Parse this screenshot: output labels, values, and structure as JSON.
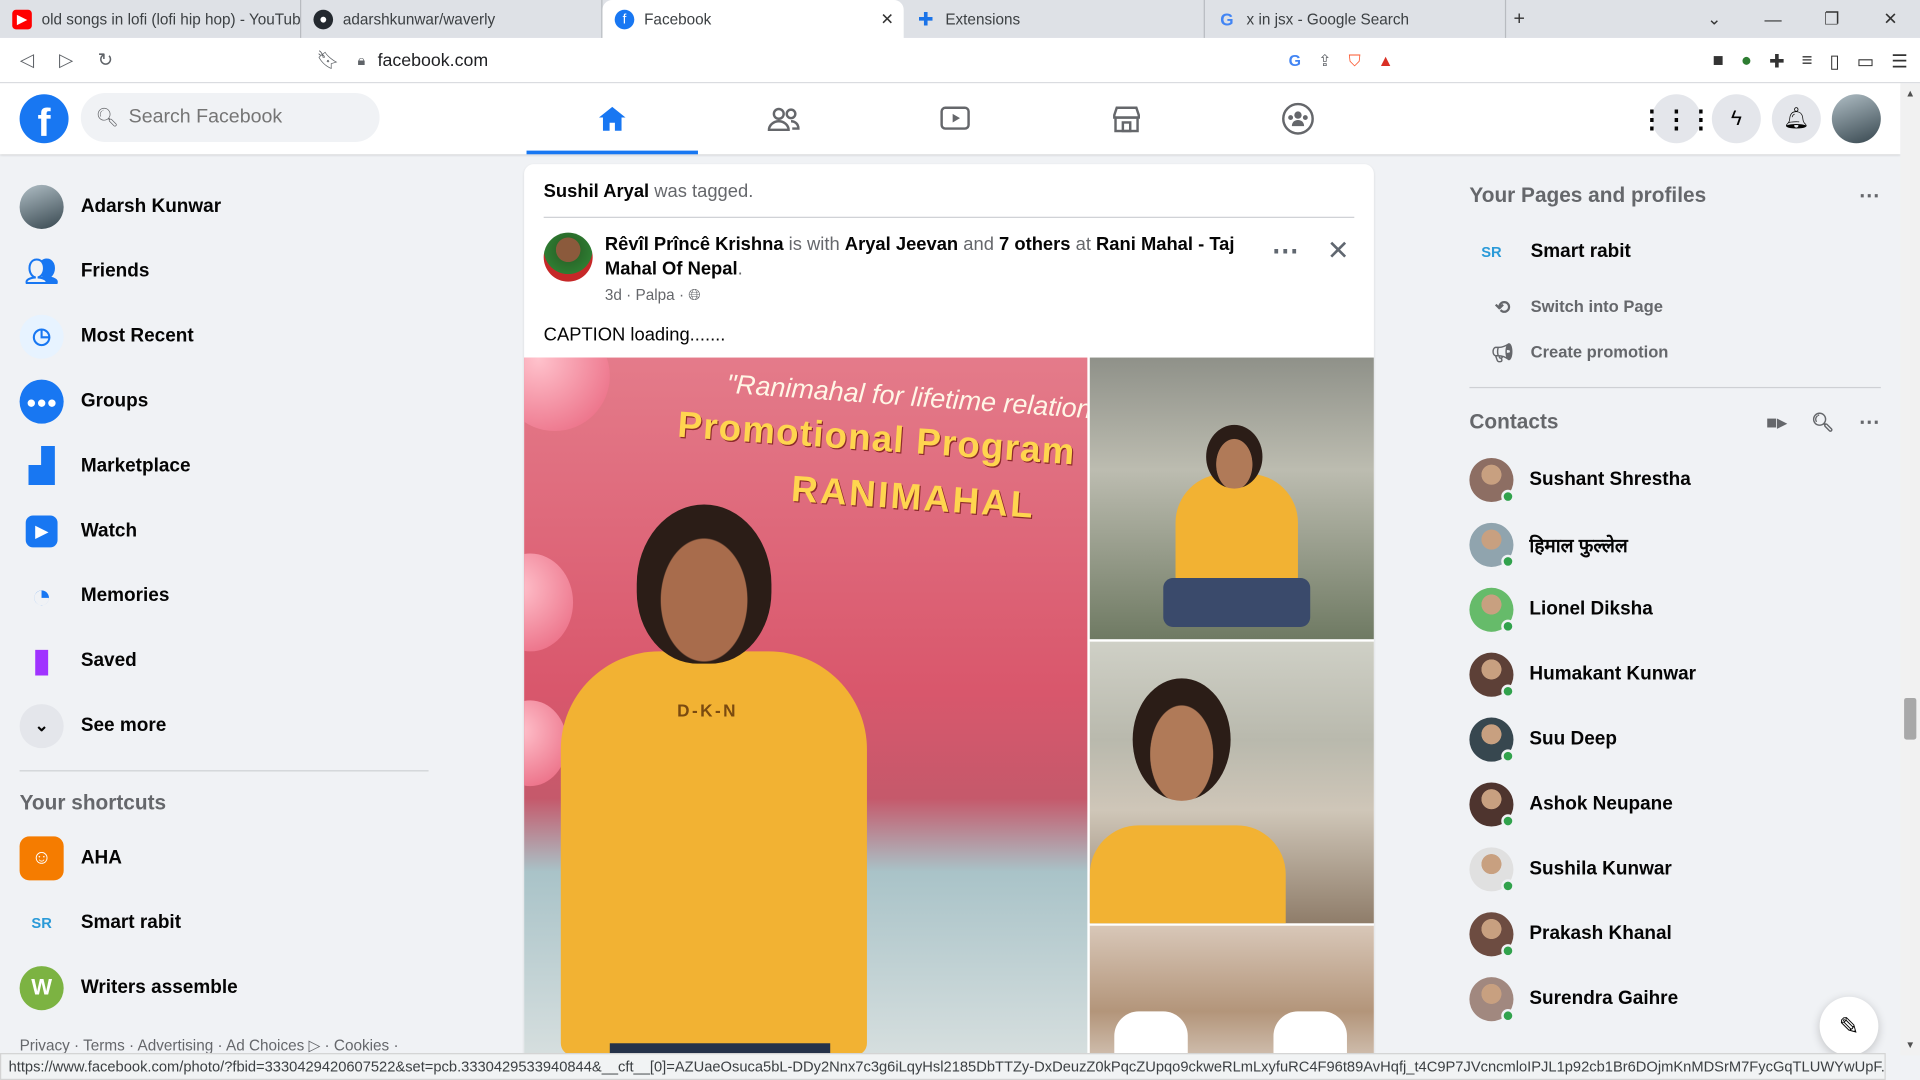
{
  "browser": {
    "tabs": [
      {
        "title": "old songs in lofi (lofi hip hop) - YouTube",
        "icon": "youtube-icon",
        "color": "#ff0000"
      },
      {
        "title": "adarshkunwar/waverly",
        "icon": "github-icon",
        "color": "#24292f"
      },
      {
        "title": "Facebook",
        "icon": "facebook-icon",
        "color": "#1877f2",
        "active": true
      },
      {
        "title": "Extensions",
        "icon": "puzzle-icon",
        "color": "#1a73e8"
      },
      {
        "title": "x in jsx - Google Search",
        "icon": "google-icon",
        "color": "#4285f4"
      }
    ],
    "url": "facebook.com",
    "status_url": "https://www.facebook.com/photo/?fbid=3330429420607522&set=pcb.3330429533940844&__cft__[0]=AZUaeOsuca5bL-DDy2Nnx7c3g6iLqyHsl2185DbTTZy-DxDeuzZ0kPqcZUpqo9ckweRLmLxyfuRC4F96t89AvHqfj_t4C9P7JVcncmloIPJL1p92cb1Br6DOjmKnMDSrM7FycGqTLUWYwUpF..."
  },
  "header": {
    "logo": "f",
    "search_placeholder": "Search Facebook",
    "nav": [
      "home-icon",
      "friends-icon",
      "watch-icon",
      "marketplace-icon",
      "groups-icon"
    ],
    "accent": "#1877f2"
  },
  "left": {
    "items": [
      {
        "label": "Adarsh Kunwar"
      },
      {
        "label": "Friends"
      },
      {
        "label": "Most Recent"
      },
      {
        "label": "Groups"
      },
      {
        "label": "Marketplace"
      },
      {
        "label": "Watch"
      },
      {
        "label": "Memories"
      },
      {
        "label": "Saved"
      },
      {
        "label": "See more"
      }
    ],
    "shortcuts_title": "Your shortcuts",
    "shortcuts": [
      {
        "label": "AHA"
      },
      {
        "label": "Smart rabit"
      },
      {
        "label": "Writers assemble"
      }
    ],
    "footer": "Privacy · Terms · Advertising · Ad Choices ▷ · Cookies ·"
  },
  "post": {
    "tagged_name": "Sushil Aryal",
    "tagged_text": " was tagged.",
    "author": "Rêvîl Prîncê Krishna",
    "with_text": " is with ",
    "with_name": "Aryal Jeevan",
    "and_text": " and ",
    "others": "7 others",
    "at_text": " at ",
    "place": "Rani Mahal - Taj Mahal Of Nepal",
    "period": ".",
    "time": "3d",
    "location": "Palpa",
    "caption": "CAPTION loading.......",
    "photo_text_1": "\"Ranimahal for lifetime relationsh",
    "photo_text_2": "Promotional Program",
    "photo_text_3": "RANIMAHAL",
    "shirt_text": "D-K-N"
  },
  "right": {
    "pages_title": "Your Pages and profiles",
    "page_name": "Smart rabit",
    "switch_label": "Switch into Page",
    "promo_label": "Create promotion",
    "contacts_title": "Contacts",
    "contacts": [
      {
        "name": "Sushant Shrestha",
        "color": "#8d6e63"
      },
      {
        "name": "हिमाल फुल्लेल",
        "color": "#90a4ae"
      },
      {
        "name": "Lionel Diksha",
        "color": "#66bb6a"
      },
      {
        "name": "Humakant Kunwar",
        "color": "#5d4037"
      },
      {
        "name": "Suu Deep",
        "color": "#37474f"
      },
      {
        "name": "Ashok Neupane",
        "color": "#4e342e"
      },
      {
        "name": "Sushila Kunwar",
        "color": "#e0e0e0"
      },
      {
        "name": "Prakash Khanal",
        "color": "#6d4c41"
      },
      {
        "name": "Surendra Gaihre",
        "color": "#a1887f"
      }
    ]
  }
}
